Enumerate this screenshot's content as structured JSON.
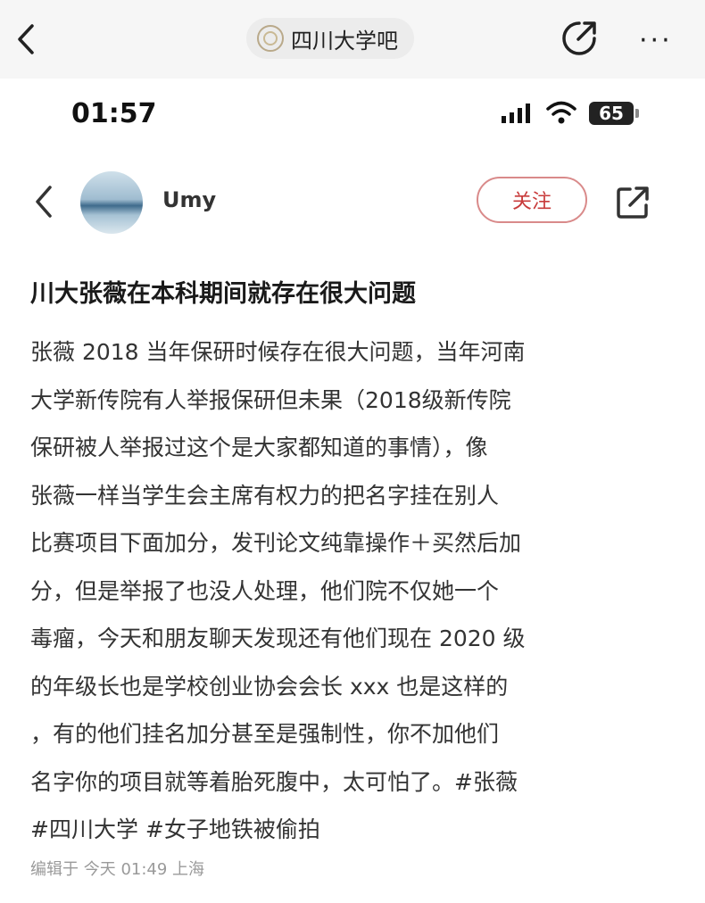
{
  "topbar": {
    "forum_name": "四川大学吧",
    "more_label": "···"
  },
  "status_bar": {
    "time": "01:57",
    "battery": "65"
  },
  "post": {
    "username": "Umy",
    "follow_label": "关注",
    "title": "川大张薇在本科期间就存在很大问题",
    "body_lines": [
      "张薇 2018 当年保研时候存在很大问题，当年河南",
      "大学新传院有人举报保研但未果（2018级新传院",
      "保研被人举报过这个是大家都知道的事情），像",
      "张薇一样当学生会主席有权力的把名字挂在别人",
      "比赛项目下面加分，发刊论文纯靠操作＋买然后加",
      "分，但是举报了也没人处理，他们院不仅她一个",
      "毒瘤，今天和朋友聊天发现还有他们现在 2020 级",
      "的年级长也是学校创业协会会长 xxx 也是这样的",
      "，有的他们挂名加分甚至是强制性，你不加他们",
      "名字你的项目就等着胎死腹中，太可怕了。#张薇",
      "#四川大学  #女子地铁被偷拍"
    ],
    "meta": "编辑于  今天 01:49  上海"
  },
  "colors": {
    "follow_border": "#d98a8a",
    "follow_text": "#c83b3b",
    "topbar_bg": "#f6f6f6"
  },
  "icons": [
    "back-icon",
    "forum-logo-icon",
    "share-icon",
    "more-icon",
    "signal-icon",
    "wifi-icon",
    "battery-icon",
    "avatar"
  ]
}
